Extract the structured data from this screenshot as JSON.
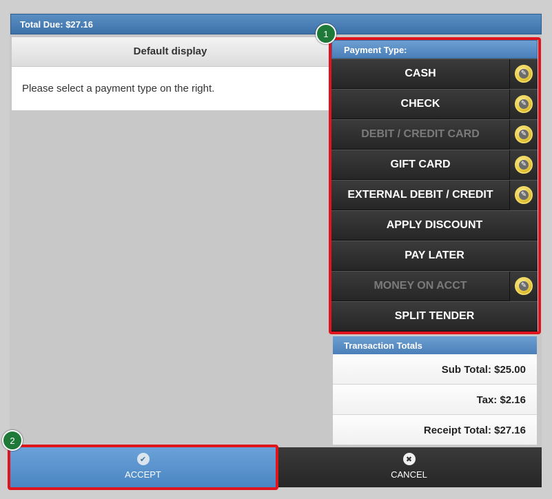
{
  "header": {
    "total_due": "Total Due: $27.16"
  },
  "left_panel": {
    "title": "Default display",
    "message": "Please select a payment type on the right."
  },
  "payment": {
    "title": "Payment Type:",
    "items": [
      {
        "label": "CASH",
        "disabled": false,
        "editable": true
      },
      {
        "label": "CHECK",
        "disabled": false,
        "editable": true
      },
      {
        "label": "DEBIT / CREDIT CARD",
        "disabled": true,
        "editable": true
      },
      {
        "label": "GIFT CARD",
        "disabled": false,
        "editable": true
      },
      {
        "label": "EXTERNAL DEBIT / CREDIT",
        "disabled": false,
        "editable": true
      },
      {
        "label": "APPLY DISCOUNT",
        "disabled": false,
        "editable": false
      },
      {
        "label": "PAY LATER",
        "disabled": false,
        "editable": false
      },
      {
        "label": "MONEY ON ACCT",
        "disabled": true,
        "editable": true
      },
      {
        "label": "SPLIT TENDER",
        "disabled": false,
        "editable": false
      }
    ]
  },
  "totals": {
    "title": "Transaction Totals",
    "sub_total": "Sub Total: $25.00",
    "tax": "Tax: $2.16",
    "receipt_total": "Receipt Total: $27.16"
  },
  "actions": {
    "accept": "ACCEPT",
    "cancel": "CANCEL"
  },
  "badges": {
    "one": "1",
    "two": "2"
  },
  "icons": {
    "edit": "pencil-icon",
    "accept": "check-icon",
    "cancel": "close-icon"
  },
  "colors": {
    "accent_blue": "#4b86c3",
    "highlight_red": "#e0141d",
    "badge_green": "#1f7a3a"
  }
}
